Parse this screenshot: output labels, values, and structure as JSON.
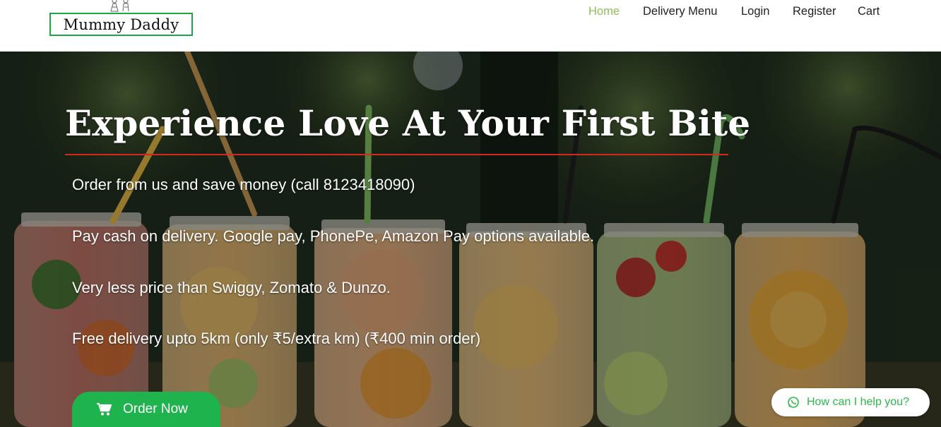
{
  "brand": {
    "name": "Mummy Daddy"
  },
  "nav": {
    "items": [
      {
        "label": "Home",
        "active": true
      },
      {
        "label": "Delivery Menu",
        "active": false
      },
      {
        "label": "Login",
        "active": false
      },
      {
        "label": "Register",
        "active": false
      },
      {
        "label": "Cart",
        "active": false
      }
    ]
  },
  "hero": {
    "title": "Experience Love At Your First Bite",
    "lines": [
      "Order from us and save money (call 8123418090)",
      "Pay cash on delivery. Google pay, PhonePe, Amazon Pay options available.",
      "Very less price than Swiggy, Zomato & Dunzo.",
      "Free delivery upto 5km (only ₹5/extra km) (₹400 min order)"
    ],
    "order_button": {
      "label": "Order Now",
      "icon": "cart-icon"
    }
  },
  "chat_widget": {
    "label": "How can I help you?",
    "icon": "whatsapp-icon"
  },
  "colors": {
    "accent_green": "#1fb34d",
    "nav_active": "#8fbd5a",
    "title_rule": "#d2281f",
    "logo_border": "#1fa64a"
  }
}
